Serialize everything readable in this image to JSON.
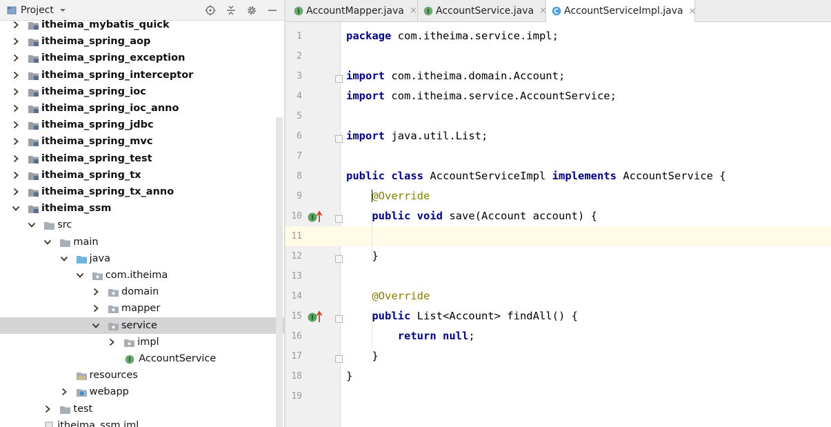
{
  "project_panel": {
    "title": "Project",
    "tree": [
      {
        "label": "itheima_mybatis_quick",
        "bold": true,
        "arrow": "right",
        "icon": "module-folder-icon"
      },
      {
        "label": "itheima_spring_aop",
        "bold": true,
        "arrow": "right",
        "icon": "module-folder-icon"
      },
      {
        "label": "itheima_spring_exception",
        "bold": true,
        "arrow": "right",
        "icon": "module-folder-icon"
      },
      {
        "label": "itheima_spring_interceptor",
        "bold": true,
        "arrow": "right",
        "icon": "module-folder-icon"
      },
      {
        "label": "itheima_spring_ioc",
        "bold": true,
        "arrow": "right",
        "icon": "module-folder-icon"
      },
      {
        "label": "itheima_spring_ioc_anno",
        "bold": true,
        "arrow": "right",
        "icon": "module-folder-icon"
      },
      {
        "label": "itheima_spring_jdbc",
        "bold": true,
        "arrow": "right",
        "icon": "module-folder-icon"
      },
      {
        "label": "itheima_spring_mvc",
        "bold": true,
        "arrow": "right",
        "icon": "module-folder-icon"
      },
      {
        "label": "itheima_spring_test",
        "bold": true,
        "arrow": "right",
        "icon": "module-folder-icon"
      },
      {
        "label": "itheima_spring_tx",
        "bold": true,
        "arrow": "right",
        "icon": "module-folder-icon"
      },
      {
        "label": "itheima_spring_tx_anno",
        "bold": true,
        "arrow": "right",
        "icon": "module-folder-icon"
      },
      {
        "label": "itheima_ssm",
        "bold": true,
        "arrow": "down",
        "icon": "module-folder-icon"
      },
      {
        "label": "src",
        "bold": false,
        "arrow": "down",
        "icon": "folder-icon"
      },
      {
        "label": "main",
        "bold": false,
        "arrow": "down",
        "icon": "folder-icon"
      },
      {
        "label": "java",
        "bold": false,
        "arrow": "down",
        "icon": "source-folder-icon"
      },
      {
        "label": "com.itheima",
        "bold": false,
        "arrow": "down",
        "icon": "package-icon"
      },
      {
        "label": "domain",
        "bold": false,
        "arrow": "right",
        "icon": "package-icon"
      },
      {
        "label": "mapper",
        "bold": false,
        "arrow": "right",
        "icon": "package-icon"
      },
      {
        "label": "service",
        "bold": false,
        "arrow": "down",
        "icon": "package-icon",
        "selected": true
      },
      {
        "label": "impl",
        "bold": false,
        "arrow": "right",
        "icon": "package-icon"
      },
      {
        "label": "AccountService",
        "bold": false,
        "arrow": "none",
        "icon": "interface-icon"
      },
      {
        "label": "resources",
        "bold": false,
        "arrow": "none",
        "icon": "resources-folder-icon"
      },
      {
        "label": "webapp",
        "bold": false,
        "arrow": "right",
        "icon": "web-folder-icon"
      },
      {
        "label": "test",
        "bold": false,
        "arrow": "right",
        "icon": "folder-icon"
      },
      {
        "label": "itheima_ssm.iml",
        "bold": false,
        "arrow": "none",
        "icon": "iml-file-icon"
      }
    ]
  },
  "editor": {
    "tabs": [
      {
        "label": "AccountMapper.java",
        "icon": "interface-icon",
        "active": false
      },
      {
        "label": "AccountService.java",
        "icon": "interface-icon",
        "active": false
      },
      {
        "label": "AccountServiceImpl.java",
        "icon": "class-icon",
        "active": true
      }
    ],
    "lines": [
      {
        "n": "1",
        "text": "package com.itheima.service.impl;"
      },
      {
        "n": "2",
        "text": ""
      },
      {
        "n": "3",
        "text": "import com.itheima.domain.Account;"
      },
      {
        "n": "4",
        "text": "import com.itheima.service.AccountService;"
      },
      {
        "n": "5",
        "text": ""
      },
      {
        "n": "6",
        "text": "import java.util.List;"
      },
      {
        "n": "7",
        "text": ""
      },
      {
        "n": "8",
        "text": "public class AccountServiceImpl implements AccountService {"
      },
      {
        "n": "9",
        "text": "    @Override"
      },
      {
        "n": "10",
        "text": "    public void save(Account account) {"
      },
      {
        "n": "11",
        "text": ""
      },
      {
        "n": "12",
        "text": "    }"
      },
      {
        "n": "13",
        "text": ""
      },
      {
        "n": "14",
        "text": "    @Override"
      },
      {
        "n": "15",
        "text": "    public List<Account> findAll() {"
      },
      {
        "n": "16",
        "text": "        return null;"
      },
      {
        "n": "17",
        "text": "    }"
      },
      {
        "n": "18",
        "text": "}"
      },
      {
        "n": "19",
        "text": ""
      }
    ],
    "keywords": [
      "package",
      "import",
      "public",
      "class",
      "implements",
      "void",
      "return",
      "null"
    ],
    "colors": {
      "keyword": "#000080",
      "annotation": "#808000",
      "current_line": "#fffbe6",
      "selection": "#d4d4d4"
    }
  }
}
